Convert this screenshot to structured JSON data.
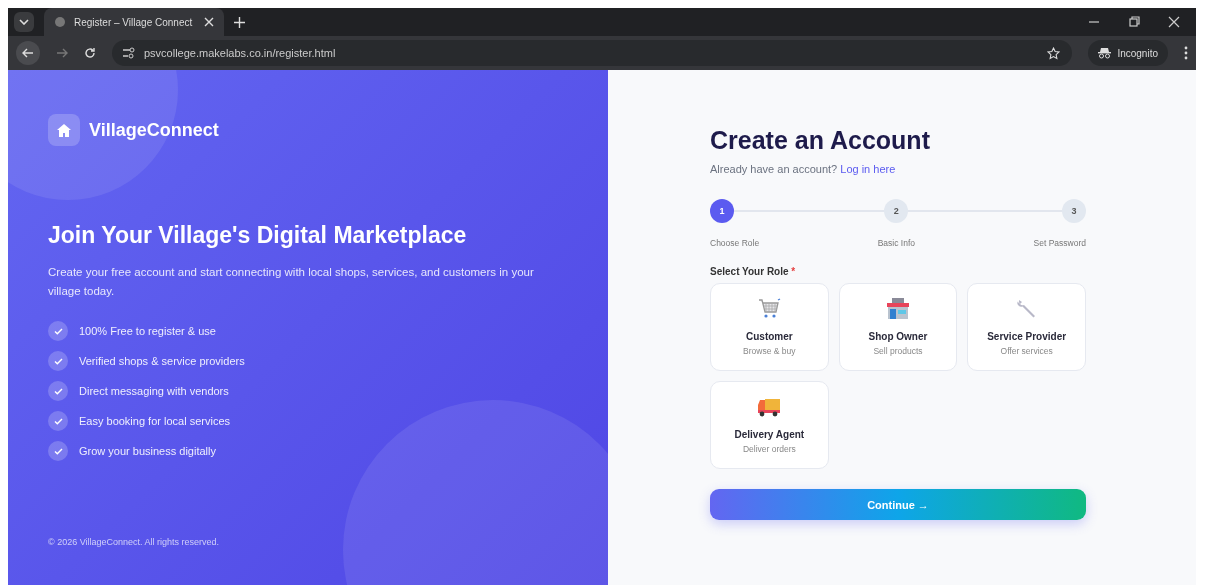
{
  "browser": {
    "tab_title": "Register – Village Connect",
    "url": "psvcollege.makelabs.co.in/register.html",
    "incognito_label": "Incognito"
  },
  "brand": {
    "name": "VillageConnect"
  },
  "hero": {
    "title": "Join Your Village's Digital Marketplace",
    "subtitle": "Create your free account and start connecting with local shops, services, and customers in your village today."
  },
  "features": [
    "100% Free to register & use",
    "Verified shops & service providers",
    "Direct messaging with vendors",
    "Easy booking for local services",
    "Grow your business digitally"
  ],
  "footer": "© 2026 VillageConnect. All rights reserved.",
  "form": {
    "title": "Create an Account",
    "login_prompt": "Already have an account?",
    "login_link": "Log in here",
    "steps": [
      {
        "number": "1",
        "label": "Choose Role",
        "selected": true
      },
      {
        "number": "2",
        "label": "Basic Info",
        "selected": false
      },
      {
        "number": "3",
        "label": "Set Password",
        "selected": false
      }
    ],
    "role_label": "Select Your Role",
    "required_mark": "*",
    "roles": [
      {
        "kind": "cart",
        "name": "Customer",
        "description": "Browse & buy",
        "selected": false
      },
      {
        "kind": "shop",
        "name": "Shop Owner",
        "description": "Sell products",
        "selected": false
      },
      {
        "kind": "wrench",
        "name": "Service Provider",
        "description": "Offer services",
        "selected": false
      },
      {
        "kind": "truck",
        "name": "Delivery Agent",
        "description": "Deliver orders",
        "selected": false
      }
    ],
    "continue_label": "Continue →"
  }
}
